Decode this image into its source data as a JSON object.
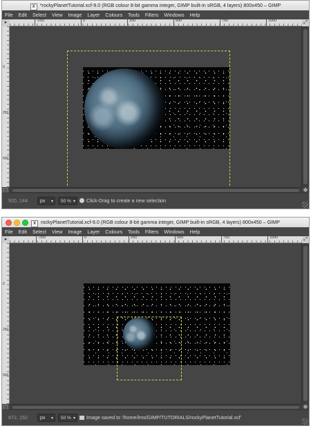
{
  "windows": [
    {
      "title": "*rockyPlanetTutorial.xcf-9.0 (RGB colour 8-bit gamma integer, GIMP built-in sRGB, 4 layers) 800x450 – GIMP",
      "menu": [
        "File",
        "Edit",
        "Select",
        "View",
        "Image",
        "Layer",
        "Colours",
        "Tools",
        "Filters",
        "Windows",
        "Help"
      ],
      "ruler_labels": [
        "-250",
        "0",
        "250",
        "500",
        "750",
        "1000"
      ],
      "vruler_labels": [
        "0",
        "250",
        "500"
      ],
      "status": {
        "coords": "920, 144",
        "unit": "px",
        "zoom": "50 %",
        "message": "Click-Drag to create a new selection"
      }
    },
    {
      "title": "rockyPlanetTutorial.xcf-9.0 (RGB colour 8-bit gamma integer, GIMP built-in sRGB, 4 layers) 800x450 – GIMP",
      "menu": [
        "File",
        "Edit",
        "Select",
        "View",
        "Image",
        "Layer",
        "Colours",
        "Tools",
        "Filters",
        "Windows",
        "Help"
      ],
      "ruler_labels": [
        "-250",
        "0",
        "250",
        "500",
        "750",
        "1000"
      ],
      "vruler_labels": [
        "0",
        "250",
        "500"
      ],
      "status": {
        "coords": "872, 152",
        "unit": "px",
        "zoom": "50 %",
        "message": "Image saved to '/home/lms/GIMP/TUTORIALS/rockyPlanetTutorial.xcf'"
      }
    }
  ]
}
